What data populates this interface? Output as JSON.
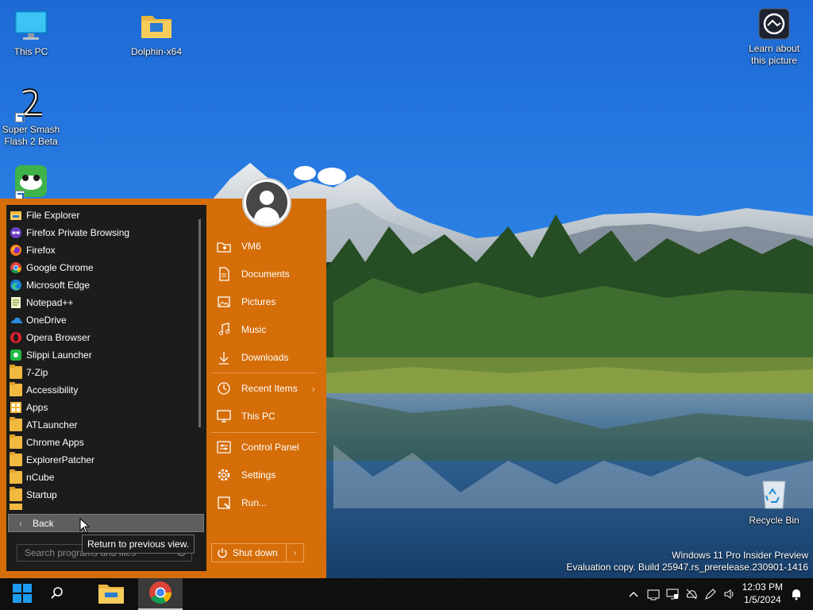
{
  "desktop": {
    "icons": [
      {
        "label": "This PC",
        "icon": "monitor-icon"
      },
      {
        "label": "Dolphin-x64",
        "icon": "folder-icon"
      },
      {
        "label": "Super Smash Flash 2 Beta",
        "icon": "smash-logo-icon"
      },
      {
        "label": "Learn about this picture",
        "icon": "camera-info-icon"
      },
      {
        "label": "Recycle Bin",
        "icon": "recycle-bin-icon"
      }
    ],
    "watermark": {
      "line1": "Windows 11 Pro Insider Preview",
      "line2": "Evaluation copy. Build 25947.rs_prerelease.230901-1416"
    }
  },
  "start_menu": {
    "programs": [
      {
        "label": "File Explorer",
        "icon": "file-explorer-icon"
      },
      {
        "label": "Firefox Private Browsing",
        "icon": "firefox-private-icon"
      },
      {
        "label": "Firefox",
        "icon": "firefox-icon"
      },
      {
        "label": "Google Chrome",
        "icon": "chrome-icon"
      },
      {
        "label": "Microsoft Edge",
        "icon": "edge-icon"
      },
      {
        "label": "Notepad++",
        "icon": "notepadpp-icon"
      },
      {
        "label": "OneDrive",
        "icon": "onedrive-icon"
      },
      {
        "label": "Opera Browser",
        "icon": "opera-icon"
      },
      {
        "label": "Slippi Launcher",
        "icon": "slippi-icon"
      },
      {
        "label": "7-Zip",
        "icon": "folder-icon"
      },
      {
        "label": "Accessibility",
        "icon": "folder-icon"
      },
      {
        "label": "Apps",
        "icon": "apps-icon"
      },
      {
        "label": "ATLauncher",
        "icon": "folder-icon"
      },
      {
        "label": "Chrome Apps",
        "icon": "folder-icon"
      },
      {
        "label": "ExplorerPatcher",
        "icon": "folder-icon"
      },
      {
        "label": "nCube",
        "icon": "folder-icon"
      },
      {
        "label": "Startup",
        "icon": "folder-icon"
      }
    ],
    "back_label": "Back",
    "back_tooltip": "Return to previous view.",
    "search_placeholder": "Search programs and files",
    "places": [
      {
        "label": "VM6",
        "icon": "user-folder-icon"
      },
      {
        "label": "Documents",
        "icon": "document-icon"
      },
      {
        "label": "Pictures",
        "icon": "picture-icon"
      },
      {
        "label": "Music",
        "icon": "music-icon"
      },
      {
        "label": "Downloads",
        "icon": "download-icon"
      },
      {
        "label": "Recent Items",
        "icon": "recent-icon",
        "has_submenu": true
      },
      {
        "label": "This PC",
        "icon": "computer-icon"
      },
      {
        "label": "Control Panel",
        "icon": "control-panel-icon"
      },
      {
        "label": "Settings",
        "icon": "settings-gear-icon"
      },
      {
        "label": "Run...",
        "icon": "run-icon"
      }
    ],
    "shutdown_label": "Shut down",
    "accent_color": "#d56d08"
  },
  "taskbar": {
    "pinned": [
      {
        "name": "start",
        "icon": "windows-logo-icon"
      },
      {
        "name": "search",
        "icon": "search-icon"
      },
      {
        "name": "file-explorer",
        "icon": "file-explorer-icon"
      },
      {
        "name": "chrome",
        "icon": "chrome-icon",
        "active": true
      }
    ],
    "tray_icons": [
      "chevron-up-icon",
      "network-icon",
      "pc-health-icon",
      "cloud-off-icon",
      "pen-icon",
      "volume-icon"
    ],
    "clock": {
      "time": "12:03 PM",
      "date": "1/5/2024"
    },
    "notification_icon": "notification-bell-icon"
  }
}
